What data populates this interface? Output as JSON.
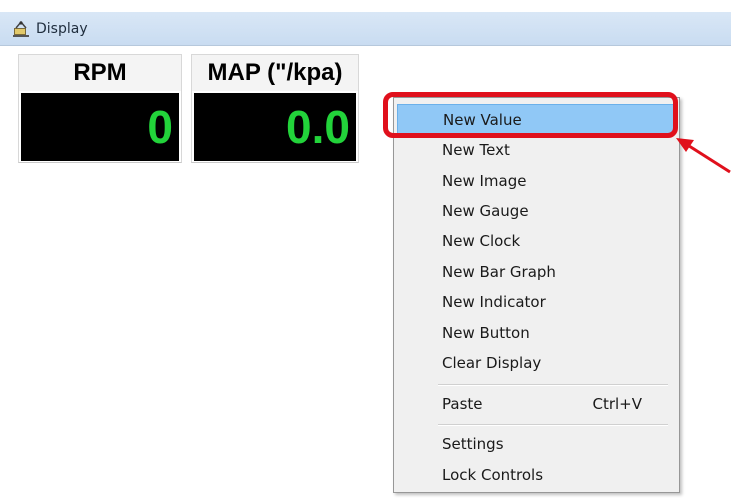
{
  "window": {
    "title": "Display"
  },
  "gauges": [
    {
      "label": "RPM",
      "value": "0"
    },
    {
      "label": "MAP (\"/kpa)",
      "value": "0.0"
    }
  ],
  "context_menu": {
    "items": [
      {
        "label": "New Value",
        "selected": true
      },
      {
        "label": "New Text"
      },
      {
        "label": "New Image"
      },
      {
        "label": "New Gauge"
      },
      {
        "label": "New Clock"
      },
      {
        "label": "New Bar Graph"
      },
      {
        "label": "New Indicator"
      },
      {
        "label": "New Button"
      },
      {
        "label": "Clear Display"
      },
      {
        "label": "Paste",
        "shortcut": "Ctrl+V"
      },
      {
        "label": "Settings"
      },
      {
        "label": "Lock Controls"
      }
    ]
  },
  "colors": {
    "value_green": "#22d33a",
    "highlight_red": "#e0101c",
    "selection_blue": "#90c8f6"
  },
  "icons": {
    "title_icon": "display-app-icon",
    "annotation": "red-arrow"
  }
}
